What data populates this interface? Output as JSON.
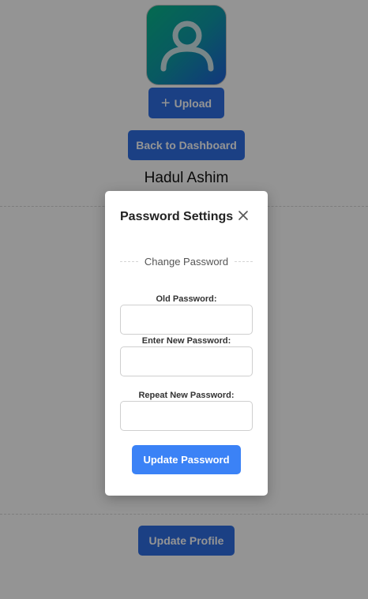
{
  "profile": {
    "avatar_icon": "user-icon",
    "upload_label": "Upload",
    "back_label": "Back to Dashboard",
    "name": "Hadul Ashim",
    "update_profile_label": "Update Profile"
  },
  "modal": {
    "title": "Password Settings",
    "close_icon": "close-icon",
    "section_label": "Change Password",
    "old_password_label": "Old Password:",
    "new_password_label": "Enter New Password:",
    "repeat_password_label": "Repeat New Password:",
    "submit_label": "Update Password"
  },
  "colors": {
    "primary": "#3b82f6",
    "overlay": "rgba(0,0,0,0.42)"
  }
}
